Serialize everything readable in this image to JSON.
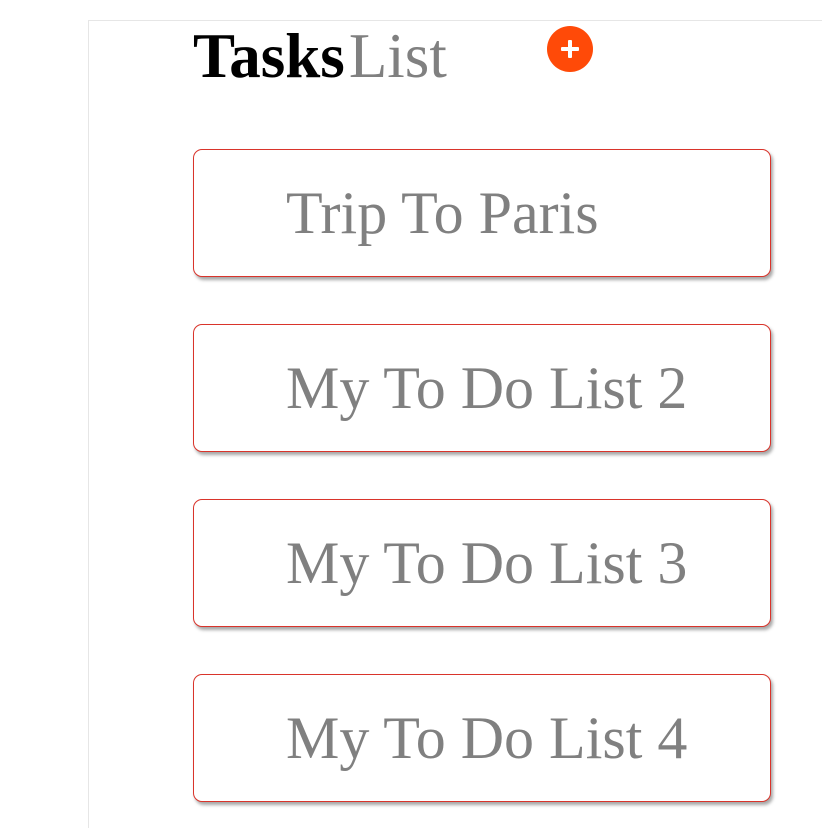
{
  "header": {
    "title_strong": "Tasks",
    "title_light": "List"
  },
  "add_button": {
    "icon": "plus-icon",
    "color": "#ff4a08"
  },
  "lists": [
    {
      "label": "Trip To Paris"
    },
    {
      "label": "My To Do List 2"
    },
    {
      "label": "My To Do List 3"
    },
    {
      "label": "My To Do List 4"
    }
  ],
  "colors": {
    "card_border": "#d9342b",
    "label_text": "#808080",
    "title_text": "#000000"
  }
}
